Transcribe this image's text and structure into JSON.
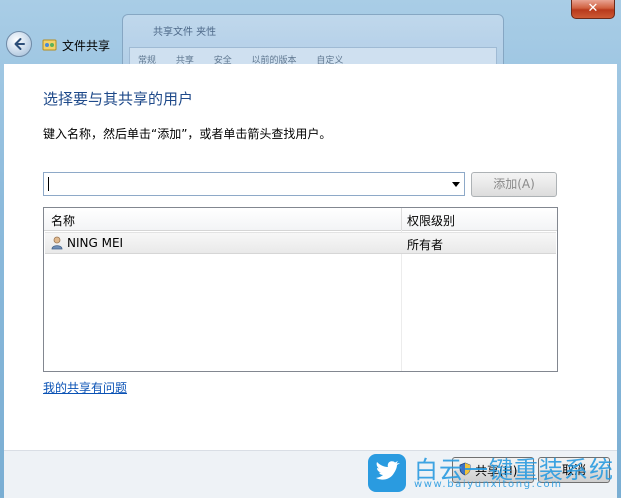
{
  "window": {
    "title": "文件共享",
    "close_label": "✕"
  },
  "background_window": {
    "title": "共享文件 夹性",
    "menu": [
      "常规",
      "共享",
      "安全",
      "以前的版本",
      "自定义"
    ]
  },
  "main": {
    "heading": "选择要与其共享的用户",
    "instruction": "键入名称，然后单击“添加”，或者单击箭头查找用户。",
    "name_input_value": "",
    "add_button_label": "添加(A)",
    "columns": [
      "名称",
      "权限级别"
    ],
    "rows": [
      {
        "name": "NING MEI",
        "permission": "所有者"
      }
    ],
    "help_link": "我的共享有问题"
  },
  "footer": {
    "share_button_label": "共享(H)",
    "cancel_button_label": "取消"
  },
  "watermark": {
    "text": "白云一键重装系统",
    "url": "www.baiyunxitong.com"
  },
  "colors": {
    "heading": "#1f4a8a",
    "link": "#0a52b5",
    "watermark": "#2a9be0"
  }
}
